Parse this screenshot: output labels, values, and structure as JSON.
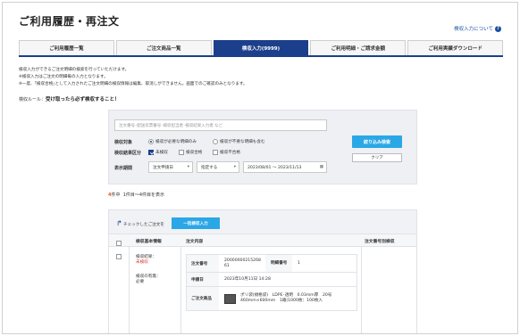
{
  "page": {
    "title": "ご利用履歴・再注文",
    "help_link": "検収入力について",
    "help_icon": "question-icon"
  },
  "tabs": [
    {
      "label": "ご利用履歴一覧",
      "active": false
    },
    {
      "label": "ご注文商品一覧",
      "active": false
    },
    {
      "label": "検収入力(9999)",
      "active": true
    },
    {
      "label": "ご利用明細・ご請求金額",
      "active": false
    },
    {
      "label": "ご利用実績ダウンロード",
      "active": false
    }
  ],
  "notes": [
    "検収入力ができるご注文明細の検索を行っていただけます。",
    "※検収入力はご注文の明細毎の入力となります。",
    "※一度、｢検収合格｣として入力されたご注文明細の検収情報は編集、取消しができません。画面でのご確認のみとなります。"
  ],
  "rule": {
    "prefix": "検収ルール：",
    "text": "受け取ったら必ず検収すること！"
  },
  "search": {
    "placeholder": "注文番号･配送伝票番号･検収担当者･検収結果入力者 など",
    "target_label": "検収対象",
    "target_options": [
      {
        "label": "検収が必要な明細のみ",
        "selected": true
      },
      {
        "label": "検収が不要な明細も含む",
        "selected": false
      }
    ],
    "result_label": "検収結果区分",
    "result_options": [
      {
        "label": "未検収",
        "checked": true
      },
      {
        "label": "検収合格",
        "checked": false
      },
      {
        "label": "検収不合格",
        "checked": false
      }
    ],
    "period_label": "表示期間",
    "period_type": "注文申請日",
    "period_mode": "指定する",
    "date_range": "2023/08/01 ～ 2023/11/13",
    "calendar_icon": "calendar-icon",
    "submit_label": "絞り込み検索",
    "clear_label": "クリア"
  },
  "result_count": {
    "count": "4",
    "unit": "件中",
    "range": "1件目～4件目を表示"
  },
  "table": {
    "bulk_hint": "チェックしたご注文を",
    "bulk_button": "一括検収入力",
    "headers": [
      "検収基本情報",
      "注文内容",
      "注文番号別検収"
    ],
    "row": {
      "result_label": "検収結果：",
      "result_value": "未検収",
      "required_label": "検収の有無：",
      "required_value": "必要",
      "order_no_label": "注文番号",
      "order_no_value": "20000000215268 61",
      "line_no_label": "明細番号",
      "line_no_value": "1",
      "date_label": "申請日",
      "date_value": "2023年10月11日 14:28",
      "product_label": "ご注文商品",
      "product_value": "ポリ袋(規格袋)　LDPE･透明　0.03mm厚　20号　460mm×600mm　1箱(1000枚：100枚入"
    }
  }
}
